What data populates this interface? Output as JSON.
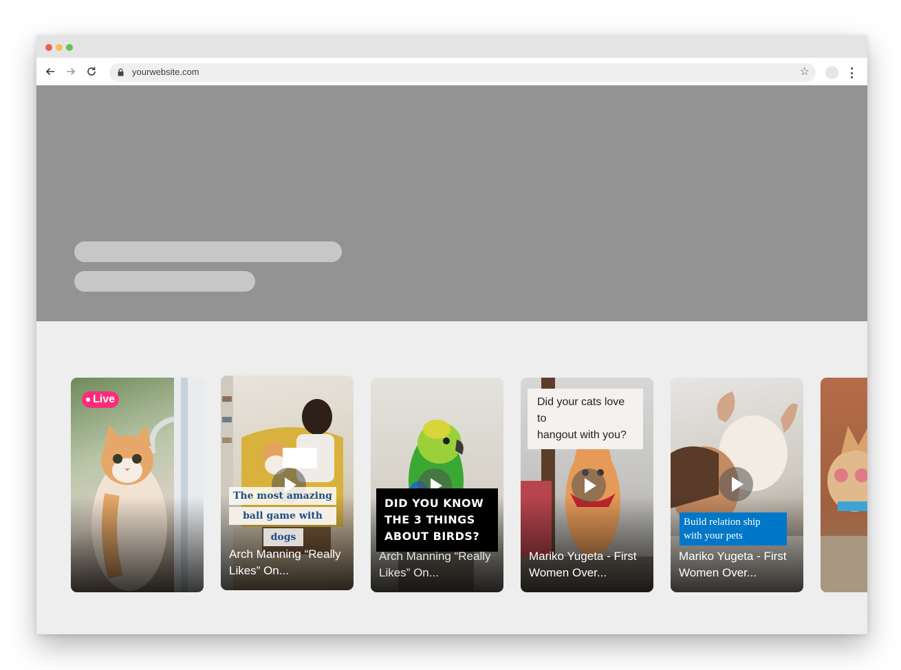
{
  "browser": {
    "url": "yourwebsite.com",
    "controls": {
      "back": "back-arrow-icon",
      "forward": "forward-arrow-icon",
      "reload": "reload-icon",
      "lock": "lock-icon",
      "bookmark": "star-icon",
      "menu": "kebab-menu-icon"
    }
  },
  "stories": [
    {
      "badge": "Live",
      "caption": "",
      "overlay": "",
      "play": false
    },
    {
      "caption": "Arch Manning “Really Likes” On...",
      "overlay_lines": [
        "The most amazing",
        "ball game with",
        "dogs"
      ],
      "play": true
    },
    {
      "caption": "Arch Manning “Really Likes” On...",
      "overlay_lines": [
        "DID YOU KNOW",
        "THE 3 THINGS",
        "ABOUT BIRDS?"
      ],
      "play": true
    },
    {
      "caption": "Mariko Yugeta - First Women Over...",
      "overlay_lines": [
        "Did your cats love to",
        "hangout with you?"
      ],
      "play": true
    },
    {
      "caption": "Mariko Yugeta - First Women Over...",
      "overlay_lines": [
        "Build relation ship",
        "with your pets"
      ],
      "play": true
    },
    {
      "caption": "",
      "play": false
    }
  ],
  "colors": {
    "live": "#ff2d7a",
    "hero": "#939393",
    "blue_tag": "#0077c8"
  }
}
